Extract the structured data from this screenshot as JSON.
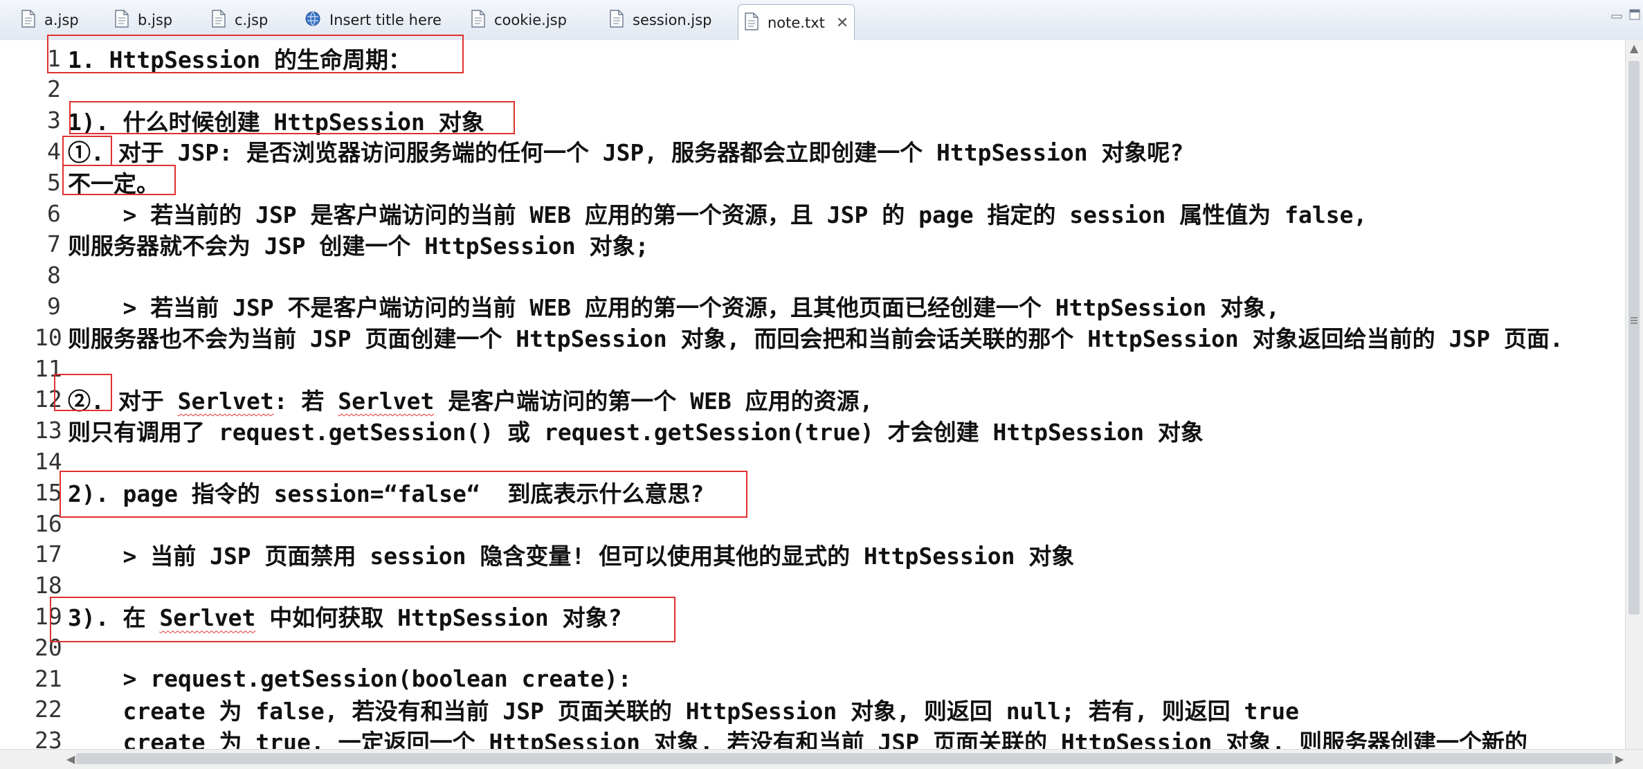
{
  "tabs": [
    {
      "label": "a.jsp",
      "icon": "jsp-file-icon"
    },
    {
      "label": "b.jsp",
      "icon": "jsp-file-icon"
    },
    {
      "label": "c.jsp",
      "icon": "jsp-file-icon"
    },
    {
      "label": "Insert title here",
      "icon": "globe-icon"
    },
    {
      "label": "cookie.jsp",
      "icon": "jsp-file-icon"
    },
    {
      "label": "session.jsp",
      "icon": "jsp-file-icon"
    },
    {
      "label": "note.txt",
      "icon": "text-file-icon",
      "active": true
    }
  ],
  "editor": {
    "lines": [
      {
        "num": "1",
        "text": "1. HttpSession 的生命周期："
      },
      {
        "num": "2",
        "text": ""
      },
      {
        "num": "3",
        "text": "1). 什么时候创建 HttpSession 对象"
      },
      {
        "num": "4",
        "text": "①. 对于 JSP: 是否浏览器访问服务端的任何一个 JSP, 服务器都会立即创建一个 HttpSession 对象呢?"
      },
      {
        "num": "5",
        "text": "不一定。"
      },
      {
        "num": "6",
        "text": "    > 若当前的 JSP 是客户端访问的当前 WEB 应用的第一个资源，且 JSP 的 page 指定的 session 属性值为 false,"
      },
      {
        "num": "7",
        "text": "则服务器就不会为 JSP 创建一个 HttpSession 对象;"
      },
      {
        "num": "8",
        "text": ""
      },
      {
        "num": "9",
        "text": "    > 若当前 JSP 不是客户端访问的当前 WEB 应用的第一个资源，且其他页面已经创建一个 HttpSession 对象,"
      },
      {
        "num": "10",
        "text": "则服务器也不会为当前 JSP 页面创建一个 HttpSession 对象, 而回会把和当前会话关联的那个 HttpSession 对象返回给当前的 JSP 页面."
      },
      {
        "num": "11",
        "text": ""
      },
      {
        "num": "12",
        "text": "②. 对于 Serlvet: 若 Serlvet 是客户端访问的第一个 WEB 应用的资源,"
      },
      {
        "num": "13",
        "text": "则只有调用了 request.getSession() 或 request.getSession(true) 才会创建 HttpSession 对象"
      },
      {
        "num": "14",
        "text": ""
      },
      {
        "num": "15",
        "text": "2). page 指令的 session=“false“  到底表示什么意思?"
      },
      {
        "num": "16",
        "text": ""
      },
      {
        "num": "17",
        "text": "    > 当前 JSP 页面禁用 session 隐含变量! 但可以使用其他的显式的 HttpSession 对象"
      },
      {
        "num": "18",
        "text": ""
      },
      {
        "num": "19",
        "text": "3). 在 Serlvet 中如何获取 HttpSession 对象?"
      },
      {
        "num": "20",
        "text": ""
      },
      {
        "num": "21",
        "text": "    > request.getSession(boolean create):"
      },
      {
        "num": "22",
        "text": "    create 为 false, 若没有和当前 JSP 页面关联的 HttpSession 对象, 则返回 null; 若有, 则返回 true"
      },
      {
        "num": "23",
        "text": "    create 为 true, 一定返回一个 HttpSession 对象. 若没有和当前 JSP 页面关联的 HttpSession 对象, 则服务器创建一个新的"
      }
    ]
  },
  "colors": {
    "annotation_box": "#e03030",
    "spellcheck": "#e03030"
  }
}
